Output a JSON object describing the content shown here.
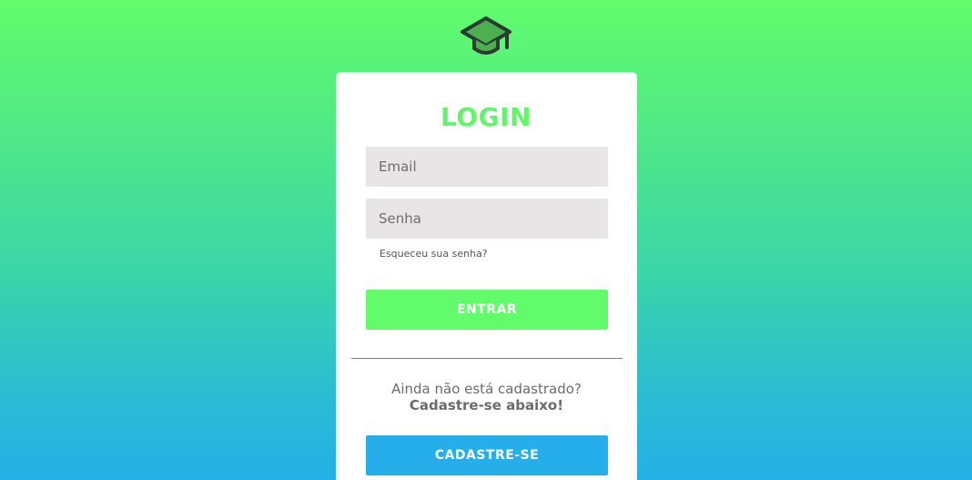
{
  "logo": {
    "icon": "graduation-cap-icon",
    "colors": {
      "outline": "#2d3a33",
      "fill": "#4caf50"
    }
  },
  "login": {
    "title": "LOGIN",
    "email_placeholder": "Email",
    "password_placeholder": "Senha",
    "forgot_link": "Esqueceu sua senha?",
    "submit_label": "ENTRAR"
  },
  "signup": {
    "prompt": "Ainda não está cadastrado?",
    "cta_text": "Cadastre-se abaixo!",
    "button_label": "CADASTRE-SE"
  },
  "colors": {
    "accent_green": "#62fb6c",
    "accent_blue": "#25aee9",
    "gradient_top": "#62fc6c",
    "gradient_bottom": "#25b0e6"
  }
}
